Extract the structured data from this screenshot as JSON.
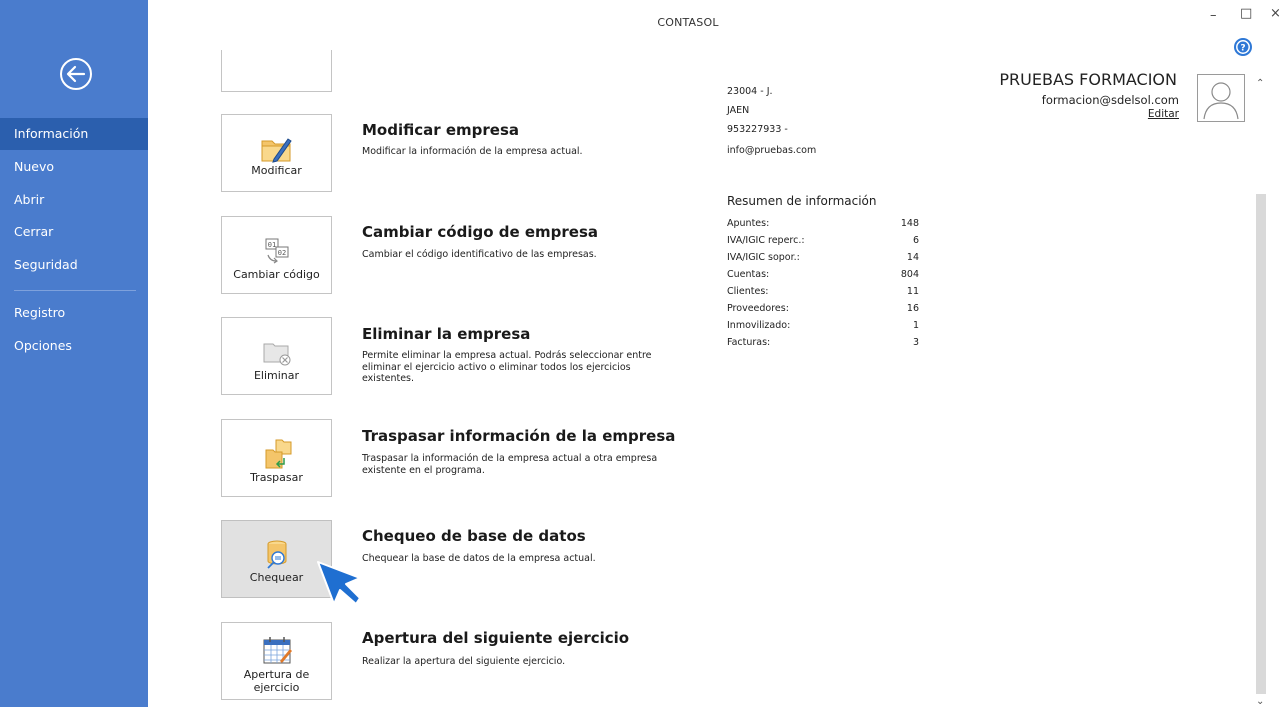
{
  "app": {
    "title": "CONTASOL"
  },
  "window_controls": {
    "minimize": "–",
    "maximize": "□",
    "close": "×"
  },
  "sidebar": {
    "items": [
      {
        "label": "Información",
        "active": true
      },
      {
        "label": "Nuevo"
      },
      {
        "label": "Abrir"
      },
      {
        "label": "Cerrar"
      },
      {
        "label": "Seguridad"
      },
      {
        "label": "Registro"
      },
      {
        "label": "Opciones"
      }
    ]
  },
  "actions": [
    {
      "tile_label": "Modificar",
      "title": "Modificar empresa",
      "desc": "Modificar la información de la empresa actual.",
      "icon": "folder-pencil-icon"
    },
    {
      "tile_label": "Cambiar código",
      "title": "Cambiar código de empresa",
      "desc": "Cambiar el código identificativo de las empresas.",
      "icon": "change-code-icon"
    },
    {
      "tile_label": "Eliminar",
      "title": "Eliminar la empresa",
      "desc": "Permite eliminar la empresa actual. Podrás seleccionar entre eliminar el ejercicio activo o eliminar todos los ejercicios existentes.",
      "icon": "delete-folder-icon"
    },
    {
      "tile_label": "Traspasar",
      "title": "Traspasar información de la empresa",
      "desc": "Traspasar la información de la empresa actual a otra empresa existente en el programa.",
      "icon": "transfer-folder-icon"
    },
    {
      "tile_label": "Chequear",
      "title": "Chequeo de base de datos",
      "desc": "Chequear la base de datos de la empresa actual.",
      "icon": "database-check-icon"
    },
    {
      "tile_label": "Apertura de ejercicio",
      "tile_label_1": "Apertura de",
      "tile_label_2": "ejercicio",
      "title": "Apertura del siguiente ejercicio",
      "desc": "Realizar la apertura del siguiente ejercicio.",
      "icon": "calendar-icon"
    }
  ],
  "company": {
    "postal": "23004 - J.",
    "city": "JAEN",
    "phone": "953227933 -",
    "email": "info@pruebas.com"
  },
  "summary": {
    "title": "Resumen de información",
    "rows": [
      {
        "label": "Apuntes:",
        "value": "148"
      },
      {
        "label": "IVA/IGIC reperc.:",
        "value": "6"
      },
      {
        "label": "IVA/IGIC sopor.:",
        "value": "14"
      },
      {
        "label": "Cuentas:",
        "value": "804"
      },
      {
        "label": "Clientes:",
        "value": "11"
      },
      {
        "label": "Proveedores:",
        "value": "16"
      },
      {
        "label": "Inmovilizado:",
        "value": "1"
      },
      {
        "label": "Facturas:",
        "value": "3"
      }
    ]
  },
  "user": {
    "name": "PRUEBAS FORMACION",
    "email": "formacion@sdelsol.com",
    "edit_label": "Editar"
  },
  "colors": {
    "sidebar": "#4a7ccd",
    "sidebar_active": "#2b5fae",
    "accent": "#1f6fd1"
  }
}
